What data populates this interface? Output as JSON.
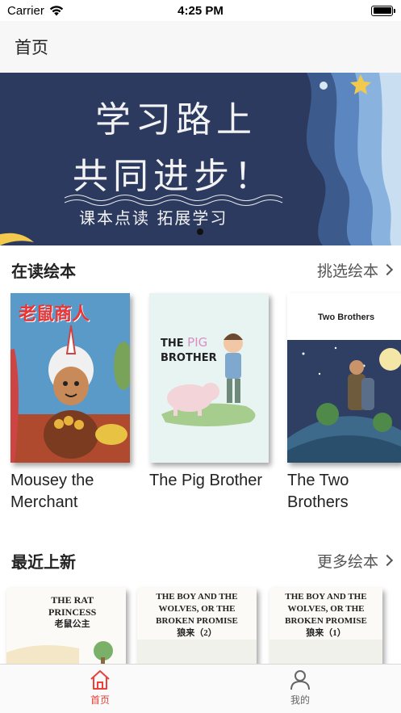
{
  "status_bar": {
    "carrier": "Carrier",
    "time": "4:25 PM"
  },
  "nav": {
    "title": "首页"
  },
  "banner": {
    "line1": "学习路上",
    "line2": "共同进步！",
    "line3": "课本点读  拓展学习"
  },
  "reading": {
    "title": "在读绘本",
    "link": "挑选绘本",
    "books": [
      {
        "title": "Mousey the Merchant",
        "cover_text": "老鼠商人"
      },
      {
        "title": "The Pig Brother",
        "cover_text_1": "THE",
        "cover_text_pig": "PIG",
        "cover_text_2": "BROTHER"
      },
      {
        "title": "The Two Brothers",
        "cover_text": "Two Brothers"
      }
    ]
  },
  "recent": {
    "title": "最近上新",
    "link": "更多绘本",
    "covers": [
      {
        "line1": "THE RAT",
        "line2": "PRINCESS",
        "line3": "老鼠公主"
      },
      {
        "line1": "THE BOY AND THE",
        "line2": "WOLVES, OR THE",
        "line3": "BROKEN PROMISE",
        "line4": "狼来（2）"
      },
      {
        "line1": "THE BOY AND THE",
        "line2": "WOLVES, OR THE",
        "line3": "BROKEN PROMISE",
        "line4": "狼来（1）"
      }
    ]
  },
  "tabs": [
    {
      "label": "首页",
      "icon": "home-icon",
      "active": true
    },
    {
      "label": "我的",
      "icon": "person-icon",
      "active": false
    }
  ],
  "colors": {
    "accent": "#e8423a",
    "banner_bg": "#2d3a5f",
    "tab_inactive": "#666666"
  }
}
